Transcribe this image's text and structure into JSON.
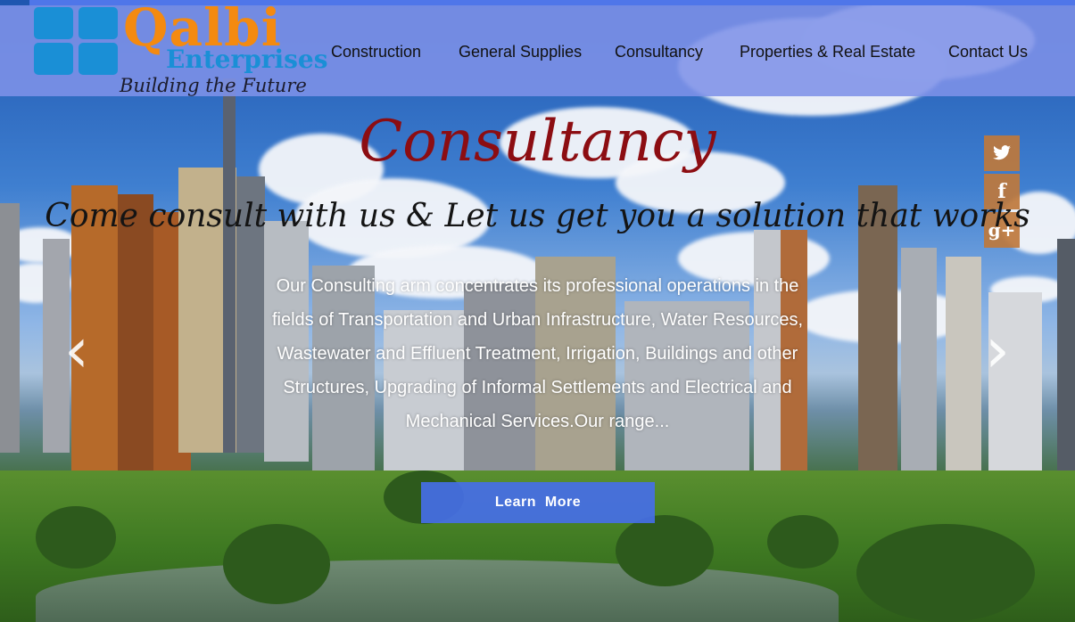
{
  "brand": {
    "name": "Qalbi",
    "subtitle": "Enterprises",
    "tagline": "Building the Future",
    "color_orange": "#f48a10",
    "color_blue": "#1a8fd6"
  },
  "nav": {
    "items": [
      {
        "label": "Construction"
      },
      {
        "label": "General Supplies"
      },
      {
        "label": "Consultancy"
      },
      {
        "label": "Properties & Real Estate"
      },
      {
        "label": "Contact Us"
      }
    ]
  },
  "social": {
    "twitter": "twitter-icon",
    "facebook": "f",
    "googleplus": "g+"
  },
  "slide": {
    "title": "Consultancy",
    "subtitle": "Come consult with us & Let us get you a solution that works",
    "body": "Our Consulting arm concentrates its professional operations in the fields of Transportation and Urban Infrastructure, Water Resources, Wastewater and Effluent Treatment, Irrigation, Buildings and other Structures, Upgrading of Informal Settlements and Electrical and Mechanical Services.Our range...",
    "button_label": "Learn  More",
    "prev_arrow": "‹",
    "next_arrow": "›"
  }
}
